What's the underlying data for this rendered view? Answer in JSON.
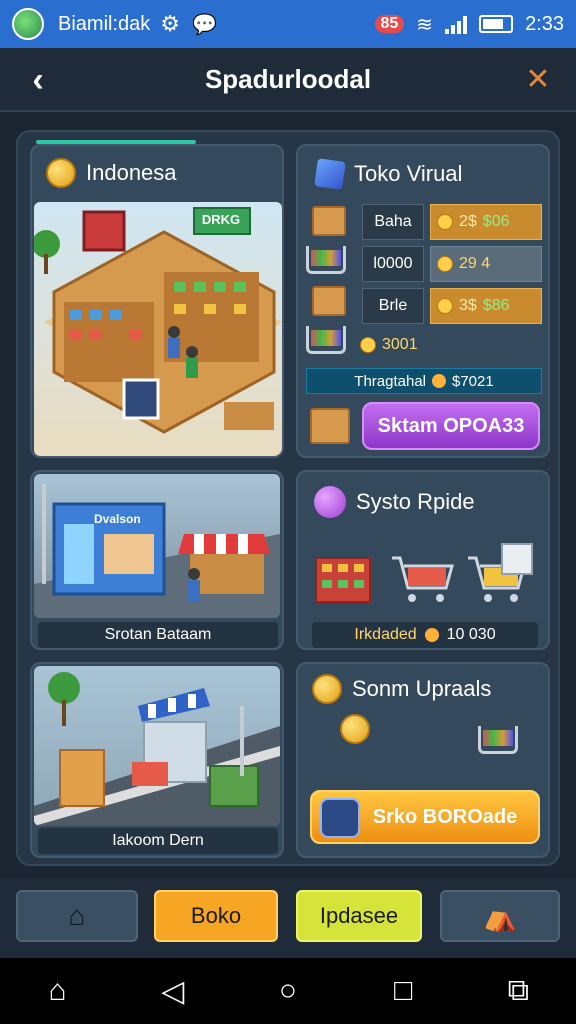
{
  "status_bar": {
    "app_name": "Biamil:dak",
    "badge": "85",
    "time": "2:33"
  },
  "header": {
    "title": "Spadurloodal"
  },
  "cards": {
    "indonesia": {
      "title": "Indonesa",
      "sign": "DRKG"
    },
    "virtual_shop": {
      "title": "Toko Virual",
      "rows": [
        {
          "name": "Baha",
          "price": "2$",
          "extra": "$06"
        },
        {
          "name": "l0000",
          "price": "29 4",
          "extra": ""
        },
        {
          "name": "Brle",
          "price": "3$",
          "extra": "$86"
        }
      ],
      "coins": "3001",
      "strip_label": "Thragtahal",
      "strip_value": "$7021",
      "button": "Sktam OPOA33"
    },
    "street": {
      "sign": "Dvalson",
      "label": "Srotan Bataam"
    },
    "system": {
      "title": "Systo Rpide",
      "label": "Irkdaded",
      "value": "10 030"
    },
    "lower_left": {
      "label": "Iakoom Dern"
    },
    "upgrades": {
      "title": "Sonm Upraals",
      "button": "Srko BOROade"
    }
  },
  "bottom_nav": {
    "shop": "Boko",
    "upgrade": "Ipdasee"
  },
  "colors": {
    "accent_orange": "#f6a623",
    "accent_yellow": "#d6e43a",
    "accent_purple": "#b45be6",
    "progress": "#2ec7a5"
  }
}
